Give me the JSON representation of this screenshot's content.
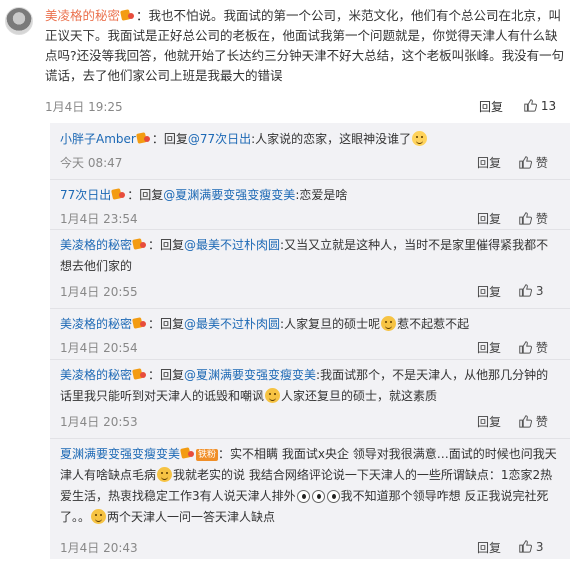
{
  "main_comment": {
    "username": "美凌格的秘密",
    "text": "：我也不怕说。我面试的第一个公司，米范文化，他们有个总公司在北京，叫正议天下。我面试是正好总公司的老板在，他面试我第一个问题就是，你觉得天津人有什么缺点吗?还没等我回答，他就开始了长达约三分钟天津不好大总结，这个老板叫张峰。我没有一句谎话，去了他们家公司上班是我最大的错误",
    "time": "1月4日 19:25",
    "reply_label": "回复",
    "like_count": "13"
  },
  "replies": [
    {
      "username": "小胖子Amber",
      "segments": [
        {
          "t": "：回复"
        },
        {
          "t": "@77次日出",
          "c": "blue"
        },
        {
          "t": ":人家说的恋家，这眼神没谁了"
        }
      ],
      "time": "今天 08:47",
      "reply_label": "回复",
      "like_label": "赞"
    },
    {
      "username": "77次日出",
      "segments": [
        {
          "t": "：回复"
        },
        {
          "t": "@夏渊满要变强变瘦变美",
          "c": "blue"
        },
        {
          "t": ":恋爱是啥"
        }
      ],
      "time": "1月4日 23:54",
      "reply_label": "回复",
      "like_label": "赞"
    },
    {
      "username": "美凌格的秘密",
      "segments": [
        {
          "t": "：回复"
        },
        {
          "t": "@最美不过朴肉圆",
          "c": "blue"
        },
        {
          "t": ":又当又立就是这种人，当时不是家里催得紧我都不想去他们家的"
        }
      ],
      "time": "1月4日 20:55",
      "reply_label": "回复",
      "like_label": "3"
    },
    {
      "username": "美凌格的秘密",
      "segments": [
        {
          "t": "：回复"
        },
        {
          "t": "@最美不过朴肉圆",
          "c": "blue"
        },
        {
          "t": ":人家复旦的硕士呢"
        },
        {
          "t": "惹不起惹不起"
        }
      ],
      "time": "1月4日 20:54",
      "reply_label": "回复",
      "like_label": "赞"
    },
    {
      "username": "美凌格的秘密",
      "segments": [
        {
          "t": "：回复"
        },
        {
          "t": "@夏渊满要变强变瘦变美",
          "c": "blue"
        },
        {
          "t": ":我面试那个，不是天津人，从他那几分钟的话里我只能听到对天津人的诋毁和嘲讽"
        },
        {
          "t": "人家还复旦的硕士，就这素质"
        }
      ],
      "time": "1月4日 20:53",
      "reply_label": "回复",
      "like_label": "赞"
    },
    {
      "username": "夏渊满要变强变瘦变美",
      "fan_badge": "铁粉",
      "segments": [
        {
          "t": "：实不相瞒 我面试x央企 领导对我很满意…面试的时候也问我天津人有啥缺点毛病"
        },
        {
          "t": "我就老实的说 我结合网络评论说一下天津人的一些所谓缺点：1恋家2热爱生活，热衷找稳定工作3有人说天津人排外"
        },
        {
          "t": "我不知道那个领导咋想 反正我说完社死了。。"
        },
        {
          "t": "两个天津人一问一答天津人缺点"
        }
      ],
      "time": "1月4日 20:43",
      "reply_label": "回复",
      "like_label": "3"
    }
  ]
}
